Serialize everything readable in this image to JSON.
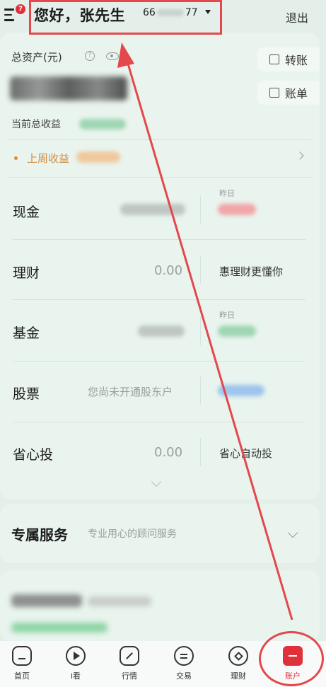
{
  "header": {
    "notification_count": "7",
    "greeting": "您好，张先生",
    "phone_prefix": "66",
    "phone_suffix": "77",
    "logout_label": "退出"
  },
  "assets": {
    "total_label": "总资产(元)",
    "help_glyph": "?",
    "transfer_label": "转账",
    "bill_label": "账单",
    "current_income_label": "当前总收益",
    "weekly_income_label": "上周收益"
  },
  "rows": [
    {
      "label": "现金",
      "yesterday_label": "昨日"
    },
    {
      "label": "理财",
      "value": "0.00",
      "note": "惠理财更懂你"
    },
    {
      "label": "基金",
      "yesterday_label": "昨日"
    },
    {
      "label": "股票",
      "prompt": "您尚未开通股东户"
    },
    {
      "label": "省心投",
      "value": "0.00",
      "note": "省心自动投"
    }
  ],
  "service": {
    "title": "专属服务",
    "subtitle": "专业用心的顾问服务"
  },
  "tabs": [
    {
      "label": "首页",
      "icon": "home-icon"
    },
    {
      "label": "i看",
      "icon": "play-icon"
    },
    {
      "label": "行情",
      "icon": "chart-icon"
    },
    {
      "label": "交易",
      "icon": "trade-icon"
    },
    {
      "label": "理财",
      "icon": "wealth-icon"
    },
    {
      "label": "账户",
      "icon": "account-icon"
    }
  ],
  "colors": {
    "accent": "#e0303a",
    "annotation": "#e4474c",
    "weekly": "#d58a3a",
    "background": "#e3efe8"
  }
}
